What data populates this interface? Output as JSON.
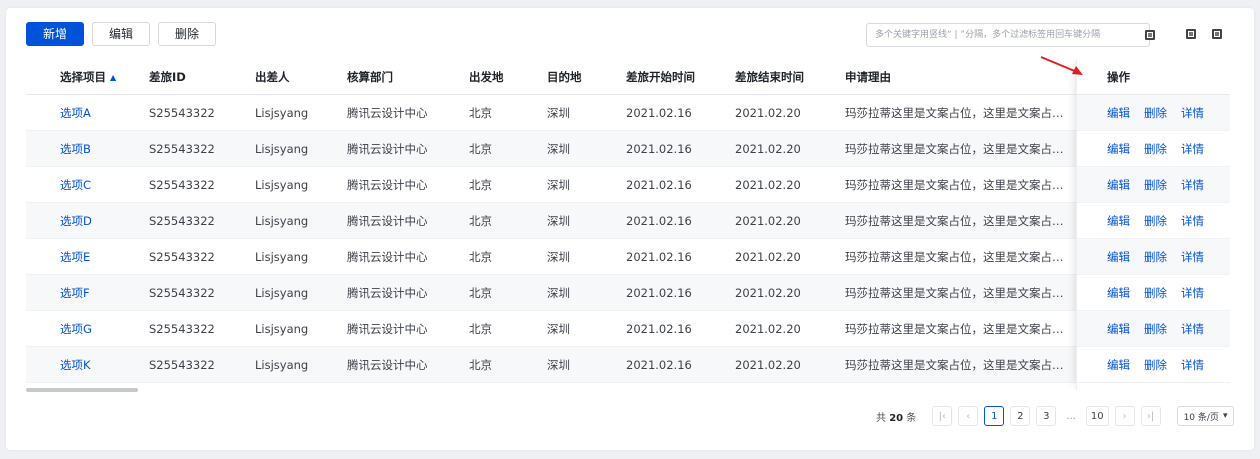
{
  "toolbar": {
    "add_label": "新增",
    "edit_label": "编辑",
    "delete_label": "删除"
  },
  "search": {
    "placeholder": "多个关键字用竖线“ | ”分隔，多个过滤标签用回车键分隔",
    "value": ""
  },
  "columns": [
    "选择项目",
    "差旅ID",
    "出差人",
    "核算部门",
    "出发地",
    "目的地",
    "差旅开始时间",
    "差旅结束时间",
    "申请理由",
    "操作"
  ],
  "rows": [
    {
      "item": "选项A",
      "id": "S25543322",
      "person": "Lisjsyang",
      "dept": "腾讯云设计中心",
      "from": "北京",
      "to": "深圳",
      "start": "2021.02.16",
      "end": "2021.02.20",
      "reason": "玛莎拉蒂这里是文案占位，这里是文案占位..."
    },
    {
      "item": "选项B",
      "id": "S25543322",
      "person": "Lisjsyang",
      "dept": "腾讯云设计中心",
      "from": "北京",
      "to": "深圳",
      "start": "2021.02.16",
      "end": "2021.02.20",
      "reason": "玛莎拉蒂这里是文案占位，这里是文案占位..."
    },
    {
      "item": "选项C",
      "id": "S25543322",
      "person": "Lisjsyang",
      "dept": "腾讯云设计中心",
      "from": "北京",
      "to": "深圳",
      "start": "2021.02.16",
      "end": "2021.02.20",
      "reason": "玛莎拉蒂这里是文案占位，这里是文案占位..."
    },
    {
      "item": "选项D",
      "id": "S25543322",
      "person": "Lisjsyang",
      "dept": "腾讯云设计中心",
      "from": "北京",
      "to": "深圳",
      "start": "2021.02.16",
      "end": "2021.02.20",
      "reason": "玛莎拉蒂这里是文案占位，这里是文案占位..."
    },
    {
      "item": "选项E",
      "id": "S25543322",
      "person": "Lisjsyang",
      "dept": "腾讯云设计中心",
      "from": "北京",
      "to": "深圳",
      "start": "2021.02.16",
      "end": "2021.02.20",
      "reason": "玛莎拉蒂这里是文案占位，这里是文案占位..."
    },
    {
      "item": "选项F",
      "id": "S25543322",
      "person": "Lisjsyang",
      "dept": "腾讯云设计中心",
      "from": "北京",
      "to": "深圳",
      "start": "2021.02.16",
      "end": "2021.02.20",
      "reason": "玛莎拉蒂这里是文案占位，这里是文案占位..."
    },
    {
      "item": "选项G",
      "id": "S25543322",
      "person": "Lisjsyang",
      "dept": "腾讯云设计中心",
      "from": "北京",
      "to": "深圳",
      "start": "2021.02.16",
      "end": "2021.02.20",
      "reason": "玛莎拉蒂这里是文案占位，这里是文案占位..."
    },
    {
      "item": "选项K",
      "id": "S25543322",
      "person": "Lisjsyang",
      "dept": "腾讯云设计中心",
      "from": "北京",
      "to": "深圳",
      "start": "2021.02.16",
      "end": "2021.02.20",
      "reason": "玛莎拉蒂这里是文案占位，这里是文案占位..."
    }
  ],
  "actions": {
    "edit": "编辑",
    "delete": "删除",
    "detail": "详情"
  },
  "pagination": {
    "total_prefix": "共",
    "total": "20",
    "total_suffix": "条",
    "pages": [
      "1",
      "2",
      "3"
    ],
    "ellipsis": "...",
    "last_page": "10",
    "current": "1",
    "page_size": "10 条/页"
  },
  "icons": [
    "sort-icon",
    "column-settings-icon",
    "fullscreen-icon",
    "refresh-icon",
    "annotation-arrow"
  ],
  "colors": {
    "primary": "#0052d9",
    "annotation": "#e02020"
  }
}
